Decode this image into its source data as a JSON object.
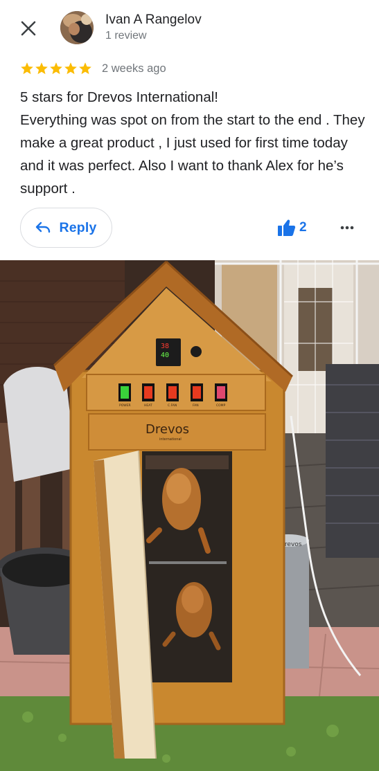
{
  "header": {
    "close_icon": "close-icon",
    "reviewer_name": "Ivan A Rangelov",
    "review_count": "1 review"
  },
  "rating": {
    "stars": 5,
    "max_stars": 5,
    "star_color": "#fbbc04",
    "date": "2 weeks ago"
  },
  "review": {
    "lines": [
      "5 stars for Drevos International!",
      "Everything was spot on from the start to the end . They make a great product , I just used for first time today and it was perfect. Also I want to thank Alex for he’s support ."
    ]
  },
  "actions": {
    "reply_label": "Reply",
    "reply_icon": "reply-arrow-icon",
    "like_icon": "thumbs-up-icon",
    "like_count": "2",
    "more_icon": "more-horizontal-icon",
    "accent_color": "#1a73e8"
  },
  "photo": {
    "description_icon": "review-photo",
    "panel_labels": [
      "POWER",
      "HEAT",
      "C.FAN",
      "FAN",
      "COMP"
    ],
    "display_top": "38",
    "display_bottom": "40",
    "brand_label": "Drevos",
    "brand_sub": "international",
    "canister_label": "Drevos"
  }
}
